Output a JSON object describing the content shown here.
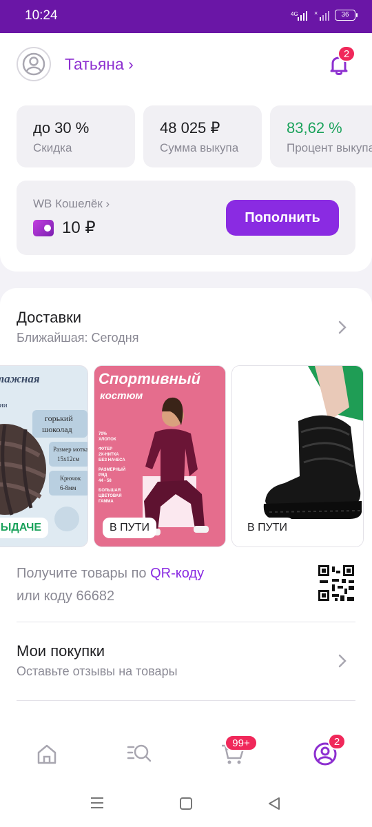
{
  "status_bar": {
    "time": "10:24",
    "network": "4G",
    "battery": "36"
  },
  "header": {
    "user_name": "Татьяна ›",
    "notifications_count": "2"
  },
  "stats": [
    {
      "value": "до 30 %",
      "label": "Скидка"
    },
    {
      "value": "48 025 ₽",
      "label": "Сумма выкупа"
    },
    {
      "value": "83,62 %",
      "label": "Процент выкупа"
    }
  ],
  "wallet": {
    "title": "WB Кошелёк ›",
    "balance": "10 ₽",
    "refill_label": "Пополнить"
  },
  "deliveries": {
    "title": "Доставки",
    "subtitle": "Ближайшая: Сегодня",
    "items": [
      {
        "status": "В К ВЫДАЧЕ",
        "image": "yarn-product-image",
        "text": "тажная",
        "lines": [
          "горький",
          "шоколад",
          "Размер мотка",
          "15х12см",
          "Крючок",
          "6-8мм"
        ]
      },
      {
        "status": "В ПУТИ",
        "image": "sport-suit-product-image",
        "text": "Спортивный",
        "text2": "костюм",
        "lines": [
          "70%",
          "ХЛОПОК",
          "ФУТЕР",
          "2Х-НИТКА",
          "БЕЗ НАЧЕСА",
          "РАЗМЕРНЫЙ",
          "РЯД",
          "44 - 58",
          "БОЛЬШАЯ",
          "ЦВЕТОВАЯ",
          "ГАММА"
        ]
      },
      {
        "status": "В ПУТИ",
        "image": "boots-product-image"
      }
    ]
  },
  "qr": {
    "text_before": "Получите товары по ",
    "link": "QR-коду",
    "text_after": "или коду 66682"
  },
  "purchases": {
    "title": "Мои покупки",
    "subtitle": "Оставьте отзывы на товары"
  },
  "bottom_nav": {
    "cart_badge": "99+",
    "profile_badge": "2"
  },
  "colors": {
    "brand": "#6a16a6",
    "accent": "#8a2be2",
    "badge": "#f0285a",
    "success": "#1aa25b"
  }
}
